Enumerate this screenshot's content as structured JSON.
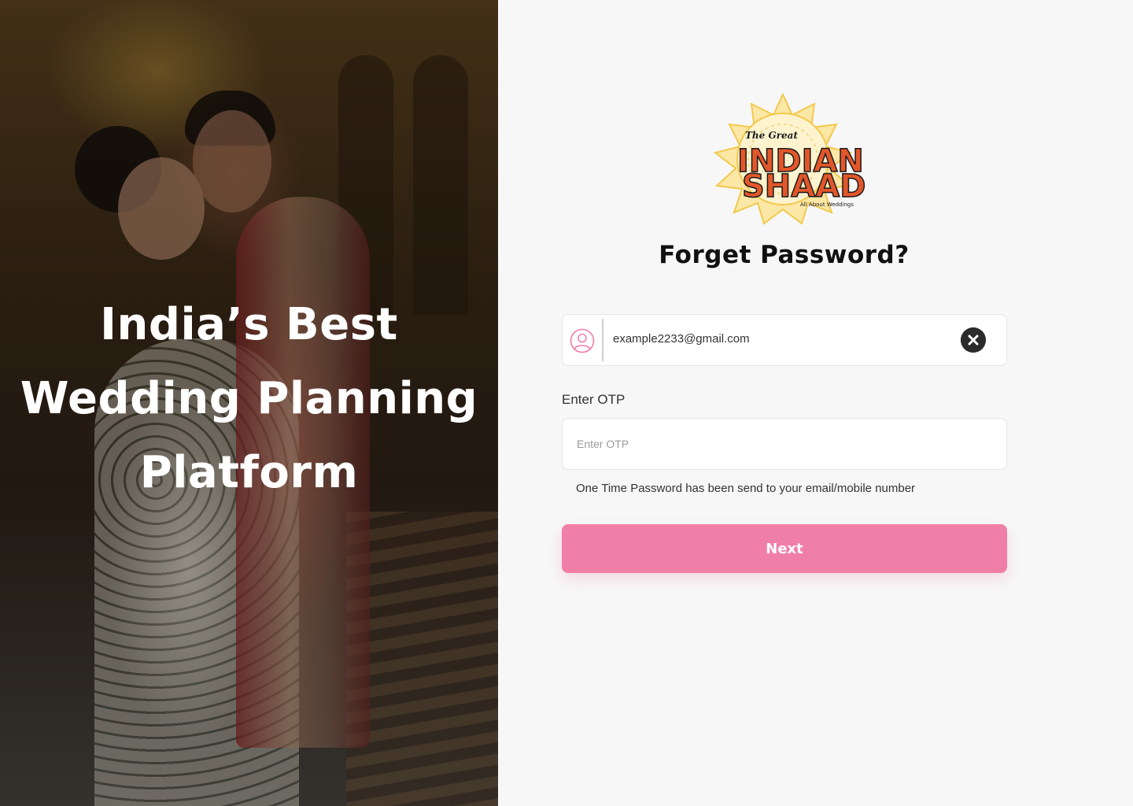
{
  "hero": {
    "title_lines": [
      "India’s Best",
      "Wedding Planning",
      "Platform"
    ]
  },
  "logo": {
    "script": "The Great",
    "word1": "INDIAN",
    "word2": "SHAADI",
    "tagline": "All About Weddings"
  },
  "form": {
    "title": "Forget  Password?",
    "email_value": "example2233@gmail.com",
    "otp_label": "Enter OTP",
    "otp_placeholder": "Enter OTP",
    "hint": "One Time Password has been send to your email/mobile number",
    "next_label": "Next"
  },
  "colors": {
    "accent": "#f07fa8",
    "user_icon": "#f07fa8",
    "clear_button": "#2b2b2b",
    "logo_orange": "#e2572a",
    "logo_gold": "#f2c94c"
  },
  "icons": {
    "user": "user-icon",
    "clear": "close-icon"
  }
}
